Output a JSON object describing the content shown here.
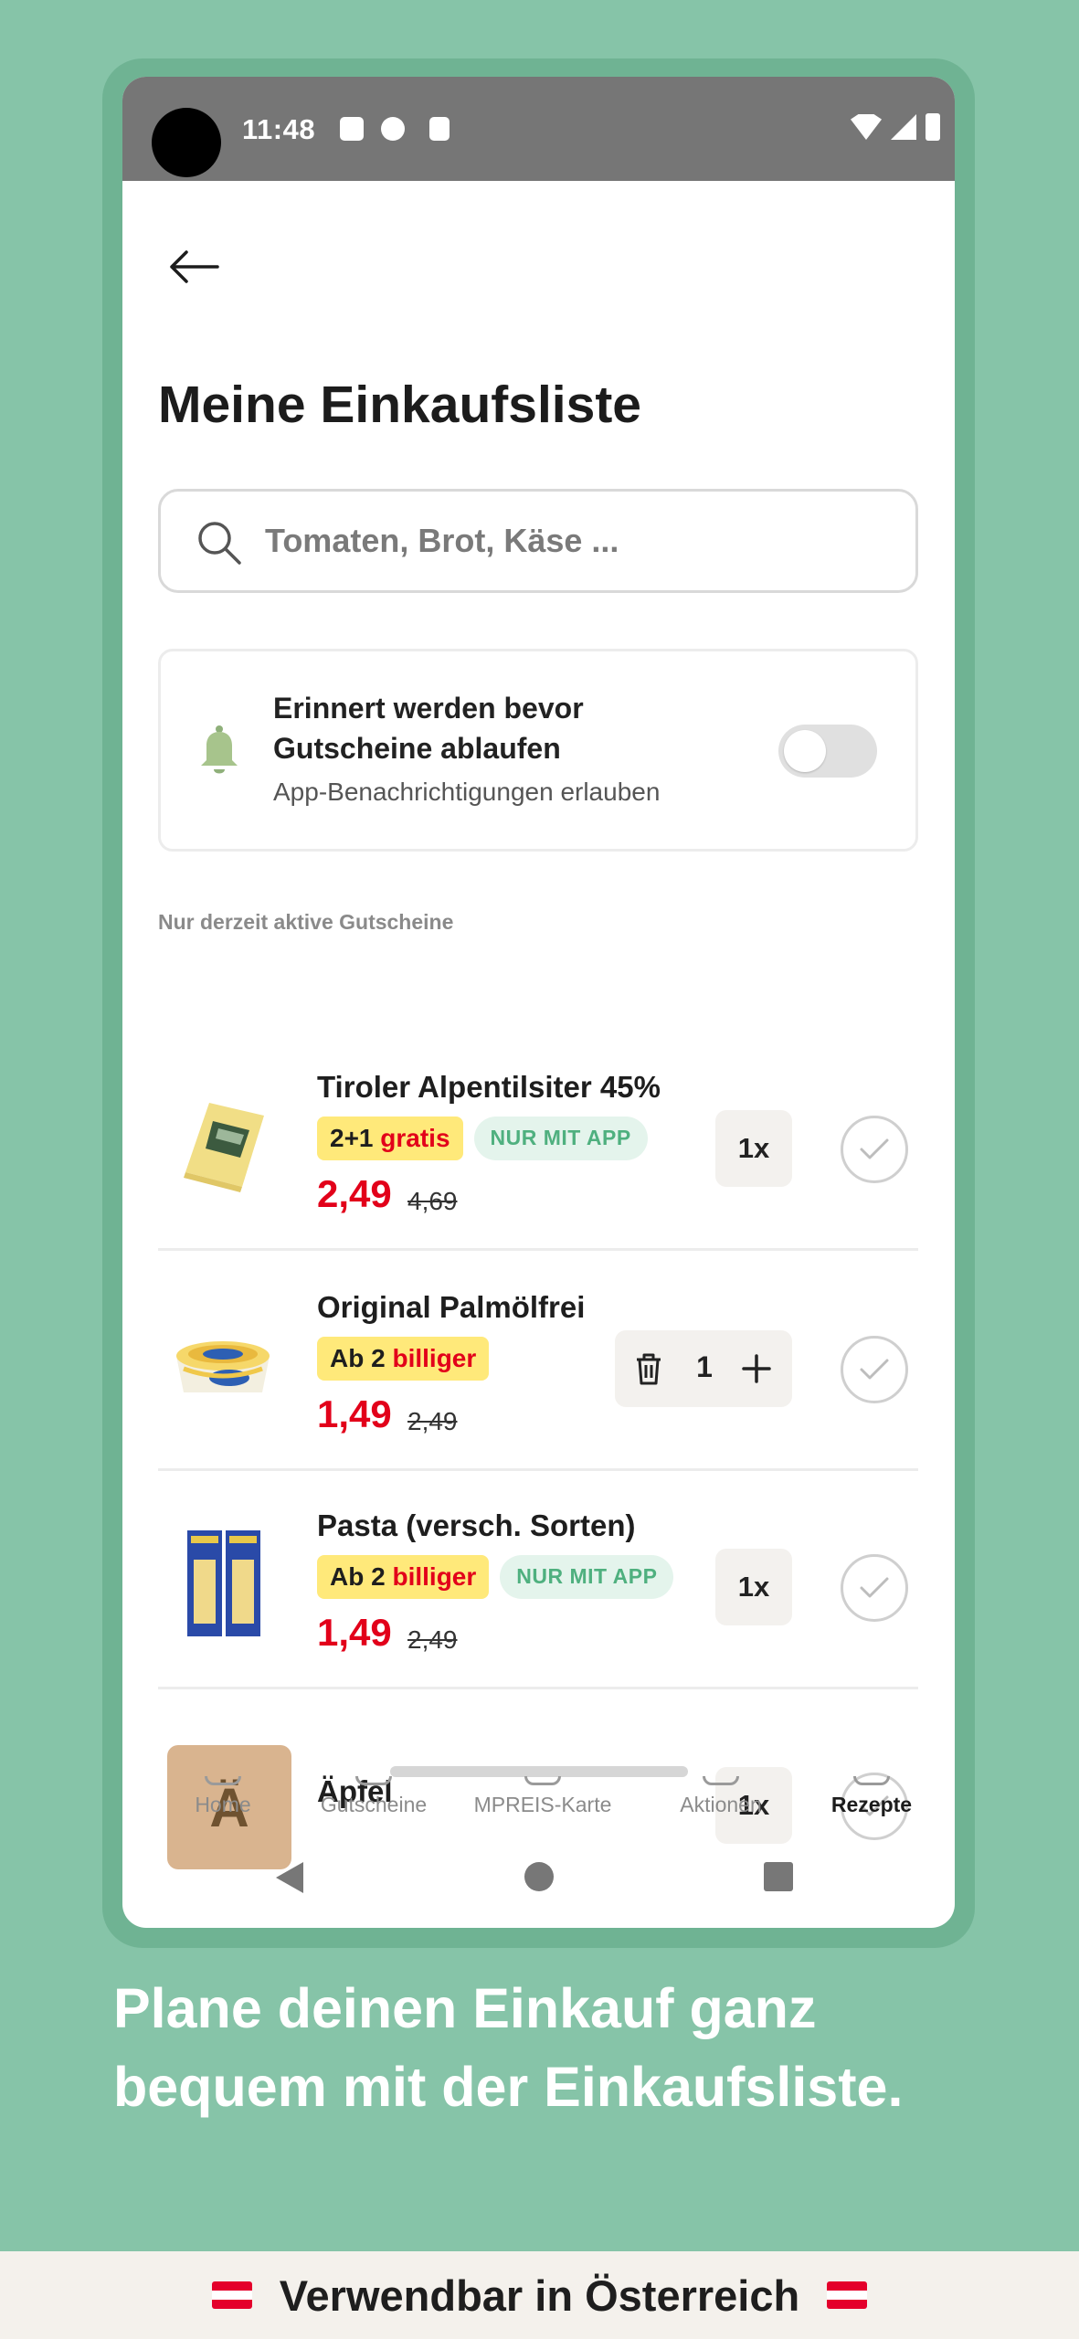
{
  "status_bar": {
    "time": "11:48"
  },
  "header": {
    "title": "Meine Einkaufsliste"
  },
  "search": {
    "placeholder": "Tomaten, Brot, Käse ..."
  },
  "reminder": {
    "title": "Erinnert werden bevor Gutscheine ablaufen",
    "subtitle": "App-Benachrichtigungen erlauben",
    "toggle_on": false
  },
  "section_label": "Nur derzeit aktive Gutscheine",
  "items": [
    {
      "name": "Tiroler Alpentilsiter 45%",
      "badge_prefix": "2+1",
      "badge_suffix": "gratis",
      "app_badge": "NUR MIT APP",
      "price": "2,49",
      "old_price": "4,69",
      "quantity": "1x"
    },
    {
      "name": "Original Palmölfrei",
      "badge_prefix": "Ab 2",
      "badge_suffix": "billiger",
      "price": "1,49",
      "old_price": "2,49",
      "stepper_value": "1"
    },
    {
      "name": "Pasta (versch. Sorten)",
      "badge_prefix": "Ab 2",
      "badge_suffix": "billiger",
      "app_badge": "NUR MIT APP",
      "price": "1,49",
      "old_price": "2,49",
      "quantity": "1x"
    },
    {
      "name": "Äpfel",
      "initial": "Ä",
      "quantity": "1x"
    }
  ],
  "bottom_nav": [
    {
      "label": "Home",
      "active": false
    },
    {
      "label": "Gutscheine",
      "active": false
    },
    {
      "label": "MPREIS-Karte",
      "active": false
    },
    {
      "label": "Aktionen",
      "active": false
    },
    {
      "label": "Rezepte",
      "active": true
    }
  ],
  "tagline": "Plane deinen Einkauf ganz bequem mit der Einkaufsliste.",
  "footer": {
    "text": "Verwendbar in Österreich"
  },
  "colors": {
    "background": "#86c4a8",
    "price_red": "#e2001a",
    "badge_yellow": "#ffe97a",
    "app_badge_green": "#4fb07f"
  }
}
